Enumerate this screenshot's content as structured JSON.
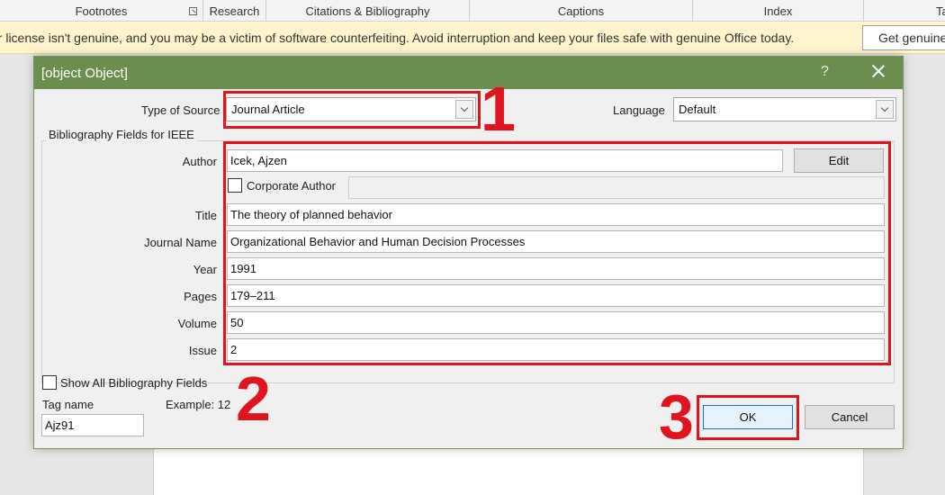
{
  "ribbon": {
    "groups": [
      "Footnotes",
      "Research",
      "Citations & Bibliography",
      "Captions",
      "Index",
      "Ta"
    ]
  },
  "license_bar": {
    "message": "ur license isn't genuine, and you may be a victim of software counterfeiting. Avoid interruption and keep your files safe with genuine Office today.",
    "button_label": "Get genuine"
  },
  "dialog": {
    "title": {
      "label": "Title",
      "value": "The theory of planned behavior"
    },
    "help": "?",
    "type_of_source": {
      "label": "Type of Source",
      "value": "Journal Article"
    },
    "language": {
      "label": "Language",
      "value": "Default"
    },
    "group_title": "Bibliography Fields for IEEE",
    "author": {
      "label": "Author",
      "value": "Icek, Ajzen",
      "edit_label": "Edit"
    },
    "corporate_author_label": "Corporate Author",
    "journal_name": {
      "label": "Journal Name",
      "value": "Organizational Behavior and Human Decision Processes"
    },
    "year": {
      "label": "Year",
      "value": "1991"
    },
    "pages": {
      "label": "Pages",
      "value": "179–211"
    },
    "volume": {
      "label": "Volume",
      "value": "50"
    },
    "issue": {
      "label": "Issue",
      "value": "2"
    },
    "show_all_label": "Show All Bibliography Fields",
    "tag_name": {
      "label": "Tag name",
      "value": "Ajz91"
    },
    "example": "Example: 12",
    "ok_label": "OK",
    "cancel_label": "Cancel"
  },
  "annotations": [
    "1",
    "2",
    "3"
  ],
  "colors": {
    "titlebar": "#6b8e4e",
    "annotation": "#e0141e",
    "license_bar": "#fff4ce"
  }
}
